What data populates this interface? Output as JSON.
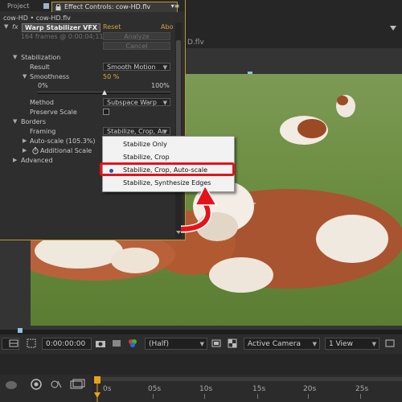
{
  "tabs": {
    "project": "Project",
    "effect_controls": "Effect Controls: cow-HD.flv",
    "menu_glyph": "▾≡"
  },
  "comp": {
    "tab_label": "D.flv"
  },
  "effect": {
    "breadcrumb": "cow-HD • cow-HD.flv",
    "fx": "fx",
    "name": "Warp Stabilizer VFX",
    "reset": "Reset",
    "about": "Abo",
    "frames_info": "164 frames @ 0:00:04;11",
    "analyze_label": "Analyze",
    "cancel_label": "Cancel"
  },
  "stabilization": {
    "header": "Stabilization",
    "result_label": "Result",
    "result_value": "Smooth Motion",
    "smoothness_label": "Smoothness",
    "smoothness_value": "50 %",
    "slider_min": "0%",
    "slider_max": "100%",
    "smoothness_level": 0.5,
    "method_label": "Method",
    "method_value": "Subspace Warp",
    "preserve_scale_label": "Preserve Scale",
    "preserve_scale_checked": false
  },
  "borders": {
    "header": "Borders",
    "framing_label": "Framing",
    "framing_value": "Stabilize, Crop, Au",
    "autoscale_label": "Auto-scale (105.3%)",
    "additional_scale_label": "Additional Scale",
    "advanced_label": "Advanced"
  },
  "framing_options": [
    {
      "label": "Stabilize Only",
      "selected": false
    },
    {
      "label": "Stabilize, Crop",
      "selected": false
    },
    {
      "label": "Stabilize, Crop, Auto-scale",
      "selected": true
    },
    {
      "label": "Stabilize, Synthesize Edges",
      "selected": false
    }
  ],
  "toolbar": {
    "timecode": "0:00:00:00",
    "resolution": "(Half)",
    "camera": "Active Camera",
    "views": "1 View"
  },
  "timeline": {
    "ticks": [
      "0s",
      "05s",
      "10s",
      "15s",
      "20s",
      "25s"
    ]
  },
  "colors": {
    "highlight_border": "#e5121a",
    "panel_border": "#bd9a2a",
    "arrow": "#e5121a",
    "value_orange": "#e3a637",
    "playhead": "#e8a21a"
  }
}
